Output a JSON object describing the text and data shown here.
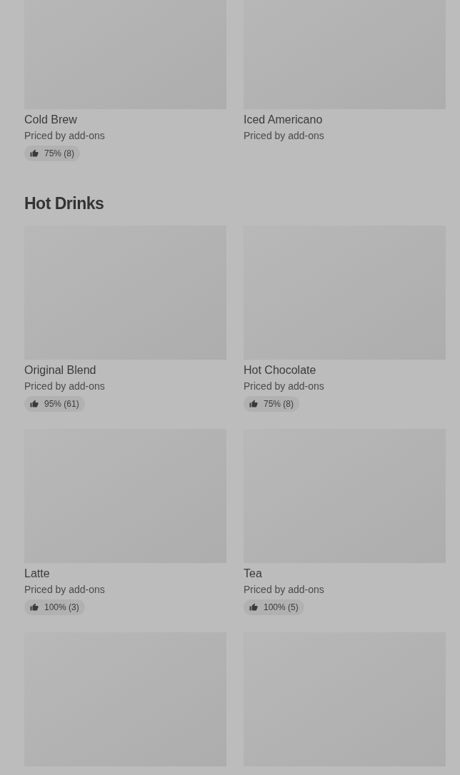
{
  "sections": [
    {
      "items": [
        {
          "kind": "card",
          "title": "Cold Brew",
          "subtitle": "Priced by add-ons",
          "rating": "75% (8)"
        },
        {
          "kind": "card",
          "title": "Iced Americano",
          "subtitle": "Priced by add-ons"
        }
      ]
    },
    {
      "title": "Hot Drinks",
      "items": [
        {
          "kind": "card",
          "title": "Original Blend",
          "subtitle": "Priced by add-ons",
          "rating": "95% (61)"
        },
        {
          "kind": "card",
          "title": "Hot Chocolate",
          "subtitle": "Priced by add-ons",
          "rating": "75% (8)"
        },
        {
          "kind": "card",
          "title": "Latte",
          "subtitle": "Priced by add-ons",
          "rating": "100% (3)"
        },
        {
          "kind": "card",
          "title": "Tea",
          "subtitle": "Priced by add-ons",
          "rating": "100% (5)"
        },
        {
          "kind": "image"
        },
        {
          "kind": "image"
        }
      ]
    }
  ]
}
